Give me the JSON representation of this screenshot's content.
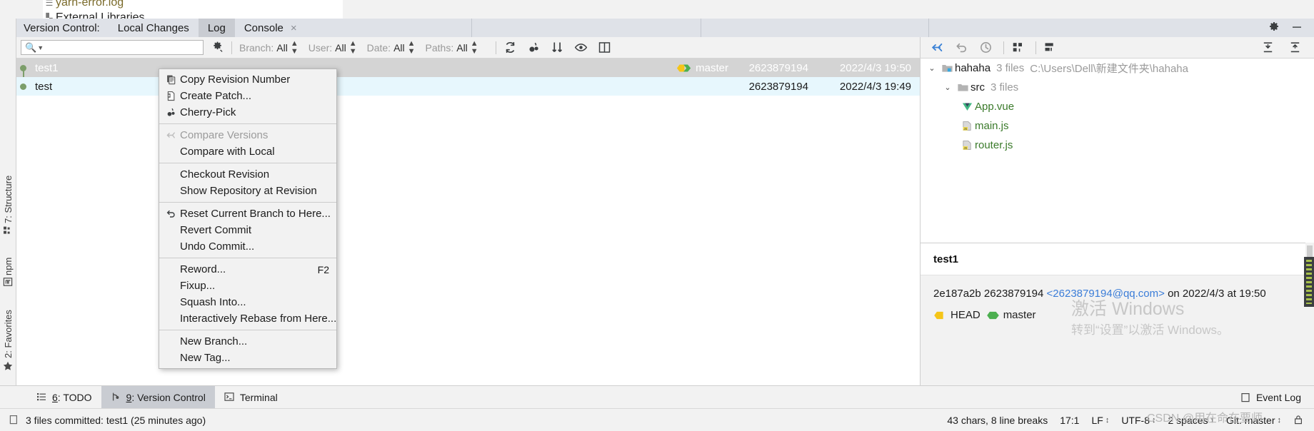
{
  "background_editor": {
    "file_row": "yarn-error.log",
    "libraries_row": "External Libraries"
  },
  "tool_window": {
    "title": "Version Control:",
    "tabs": [
      {
        "label": "Local Changes",
        "selected": false,
        "closable": false
      },
      {
        "label": "Log",
        "selected": true,
        "closable": false
      },
      {
        "label": "Console",
        "selected": false,
        "closable": true,
        "close_glyph": "×"
      }
    ],
    "header_icons": [
      {
        "name": "settings-gear-icon"
      },
      {
        "name": "hide-window-icon"
      }
    ]
  },
  "filter_bar": {
    "search_placeholder": "",
    "search_value": "",
    "search_icon": "search-icon",
    "gear_icon": "filter-settings-gear-icon",
    "filters": [
      {
        "name": "branch",
        "label": "Branch:",
        "value": "All"
      },
      {
        "name": "user",
        "label": "User:",
        "value": "All"
      },
      {
        "name": "date",
        "label": "Date:",
        "value": "All"
      },
      {
        "name": "paths",
        "label": "Paths:",
        "value": "All"
      }
    ],
    "actions": [
      {
        "name": "refresh-icon"
      },
      {
        "name": "cherry-pick-icon"
      },
      {
        "name": "collapse-sort-icon"
      },
      {
        "name": "show-details-eye-icon"
      },
      {
        "name": "open-in-editor-icon"
      }
    ],
    "right_actions": [
      {
        "name": "search-everywhere-icon"
      }
    ]
  },
  "side_toolbar": {
    "left_actions": [
      {
        "name": "jump-to-source-icon"
      },
      {
        "name": "revert-icon"
      },
      {
        "name": "show-history-icon"
      },
      {
        "name": "group-by-directory-icon"
      },
      {
        "name": "group-by-module-icon"
      }
    ],
    "right_actions": [
      {
        "name": "expand-all-icon"
      },
      {
        "name": "collapse-all-icon"
      }
    ]
  },
  "commit_list": {
    "rows": [
      {
        "subject": "test1",
        "ref_label": "master",
        "ref_icon": "branch-tag-icon",
        "author": "2623879194",
        "date": "2022/4/3 19:50",
        "selected": true
      },
      {
        "subject": "test",
        "ref_label": "",
        "ref_icon": "",
        "author": "2623879194",
        "date": "2022/4/3 19:49",
        "selected": false
      }
    ]
  },
  "context_menu": {
    "groups": [
      {
        "items": [
          {
            "label": "Copy Revision Number",
            "icon": "copy-icon",
            "shortcut": "",
            "disabled": false
          },
          {
            "label": "Create Patch...",
            "icon": "create-patch-icon",
            "shortcut": "",
            "disabled": false
          },
          {
            "label": "Cherry-Pick",
            "icon": "cherry-pick-icon",
            "shortcut": "",
            "disabled": false
          }
        ]
      },
      {
        "items": [
          {
            "label": "Compare Versions",
            "icon": "compare-versions-icon",
            "shortcut": "",
            "disabled": true
          },
          {
            "label": "Compare with Local",
            "icon": "",
            "shortcut": "",
            "disabled": false
          }
        ]
      },
      {
        "items": [
          {
            "label": "Checkout Revision",
            "icon": "",
            "shortcut": "",
            "disabled": false
          },
          {
            "label": "Show Repository at Revision",
            "icon": "",
            "shortcut": "",
            "disabled": false
          }
        ]
      },
      {
        "items": [
          {
            "label": "Reset Current Branch to Here...",
            "icon": "reset-icon",
            "shortcut": "",
            "disabled": false
          },
          {
            "label": "Revert Commit",
            "icon": "",
            "shortcut": "",
            "disabled": false
          },
          {
            "label": "Undo Commit...",
            "icon": "",
            "shortcut": "",
            "disabled": false
          }
        ]
      },
      {
        "items": [
          {
            "label": "Reword...",
            "icon": "",
            "shortcut": "F2",
            "disabled": false
          },
          {
            "label": "Fixup...",
            "icon": "",
            "shortcut": "",
            "disabled": false
          },
          {
            "label": "Squash Into...",
            "icon": "",
            "shortcut": "",
            "disabled": false
          },
          {
            "label": "Interactively Rebase from Here...",
            "icon": "",
            "shortcut": "",
            "disabled": false
          }
        ]
      },
      {
        "items": [
          {
            "label": "New Branch...",
            "icon": "",
            "shortcut": "",
            "disabled": false
          },
          {
            "label": "New Tag...",
            "icon": "",
            "shortcut": "",
            "disabled": false
          }
        ]
      }
    ]
  },
  "file_tree": {
    "rows": [
      {
        "indent": 0,
        "twisty": "⌄",
        "icon": "module-folder-icon",
        "name": "hahaha",
        "name_color": "dark",
        "meta": "3 files",
        "path": "C:\\Users\\Dell\\新建文件夹\\hahaha"
      },
      {
        "indent": 1,
        "twisty": "⌄",
        "icon": "folder-icon",
        "name": "src",
        "name_color": "dark",
        "meta": "3 files",
        "path": ""
      },
      {
        "indent": 2,
        "twisty": "",
        "icon": "vue-file-icon",
        "name": "App.vue",
        "name_color": "green",
        "meta": "",
        "path": ""
      },
      {
        "indent": 2,
        "twisty": "",
        "icon": "js-file-icon",
        "name": "main.js",
        "name_color": "green",
        "meta": "",
        "path": ""
      },
      {
        "indent": 2,
        "twisty": "",
        "icon": "js-file-icon",
        "name": "router.js",
        "name_color": "green",
        "meta": "",
        "path": ""
      }
    ]
  },
  "commit_details": {
    "subject": "test1",
    "hash": "2e187a2b",
    "author": "2623879194",
    "email": "<2623879194@qq.com>",
    "on_text": "on 2022/4/3 at",
    "time": "19:50",
    "refs": [
      {
        "label": "HEAD",
        "icon": "head-tag-icon",
        "color": "#f5c518"
      },
      {
        "label": "master",
        "icon": "branch-tag-icon",
        "color": "#4caf50"
      }
    ]
  },
  "watermark": {
    "line1": "激活 Windows",
    "line2": "转到“设置”以激活 Windows。",
    "csdn": "CSDN @用在命在要师"
  },
  "left_strip": {
    "items": [
      {
        "label": "7: Structure",
        "icon": "structure-icon"
      },
      {
        "label": "npm",
        "icon": "npm-icon"
      },
      {
        "label": "2: Favorites",
        "icon": "star-icon"
      }
    ]
  },
  "bottom_tabs": {
    "tabs": [
      {
        "num": "6",
        "label": ": TODO",
        "icon": "todo-list-icon",
        "selected": false
      },
      {
        "num": "9",
        "label": ": Version Control",
        "icon": "vcs-branch-icon",
        "selected": true
      },
      {
        "num": "",
        "label": "Terminal",
        "icon": "terminal-icon",
        "selected": false
      }
    ],
    "event_log": {
      "label": "Event Log",
      "icon": "event-log-icon"
    }
  },
  "status_bar": {
    "message_icon": "document-icon",
    "message": "3 files committed: test1 (25 minutes ago)",
    "items": [
      {
        "name": "char-count",
        "text": "43 chars, 8 line breaks",
        "arrow": false
      },
      {
        "name": "caret-position",
        "text": "17:1",
        "arrow": false
      },
      {
        "name": "line-separator",
        "text": "LF",
        "arrow": true
      },
      {
        "name": "encoding",
        "text": "UTF-8",
        "arrow": true
      },
      {
        "name": "indent",
        "text": "2 spaces",
        "arrow": true
      },
      {
        "name": "git-branch",
        "text": "Git: master",
        "arrow": true
      }
    ],
    "lock_icon": "lock-icon"
  }
}
